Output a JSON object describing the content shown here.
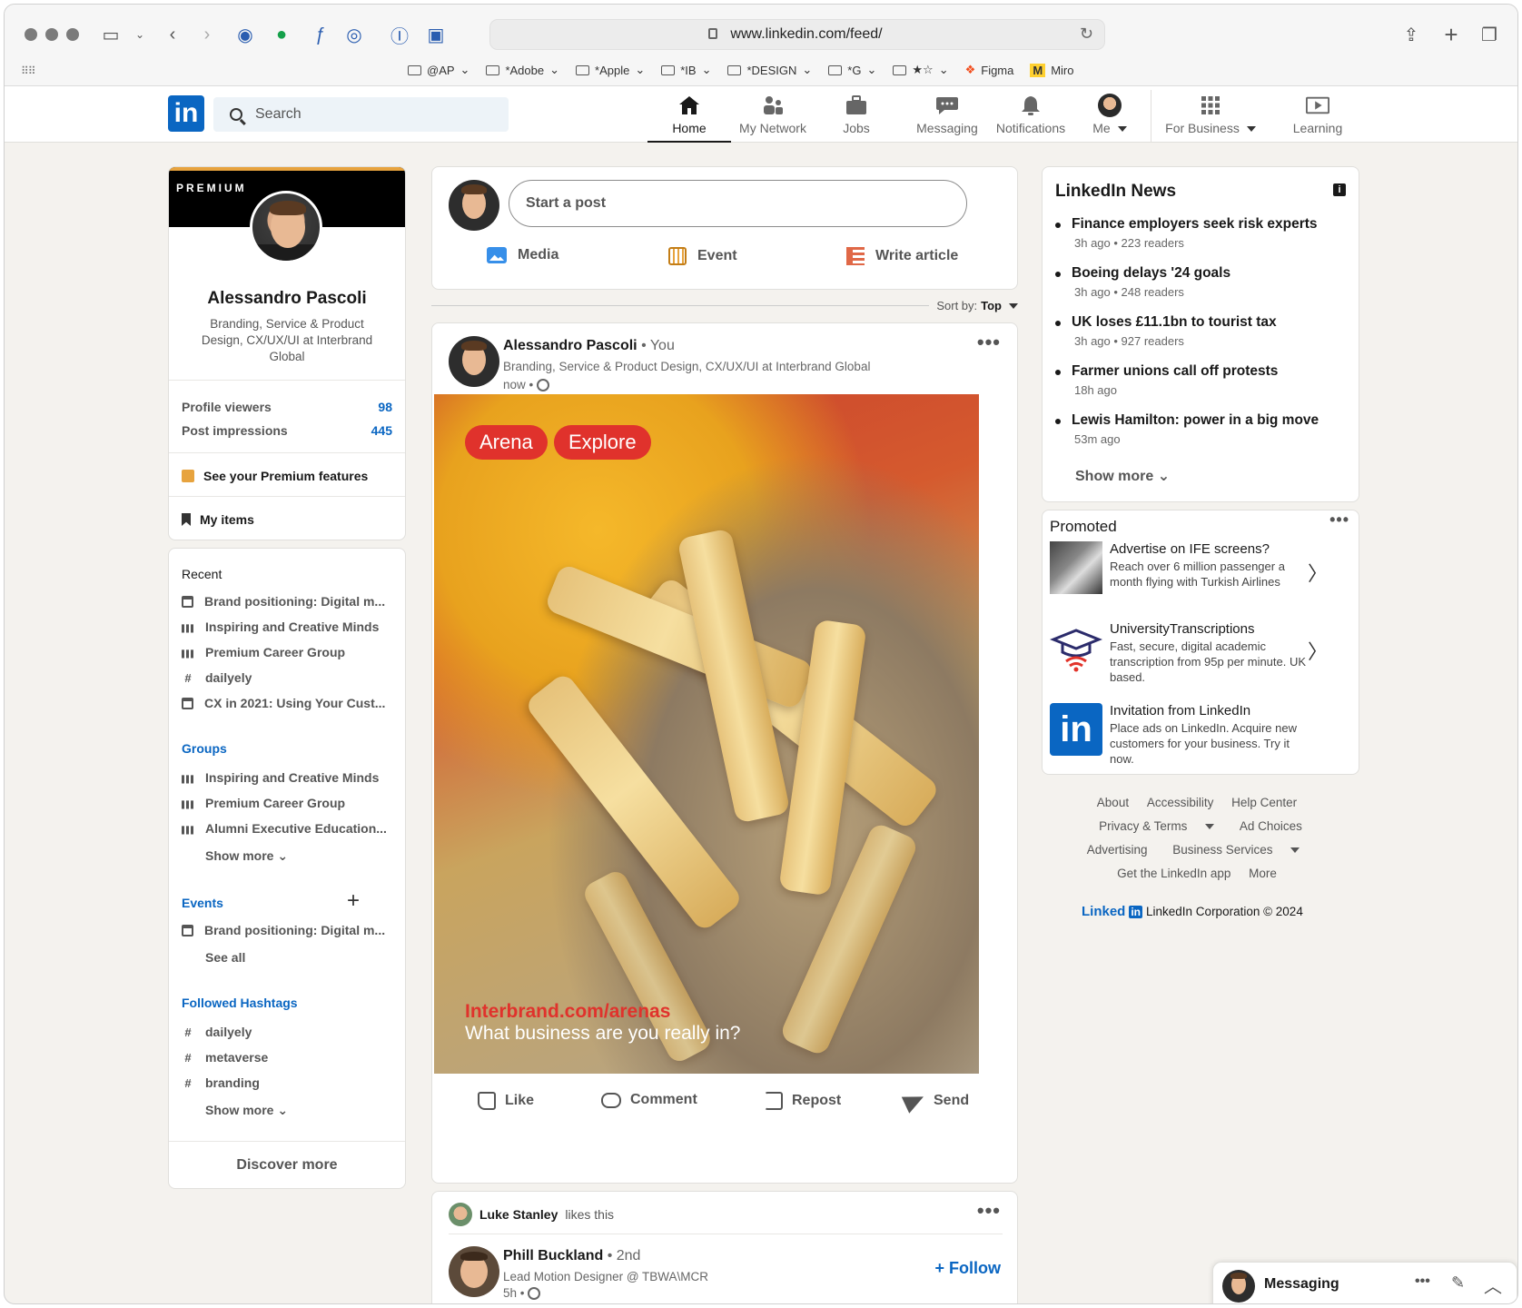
{
  "browser": {
    "url": "www.linkedin.com/feed/",
    "bookmarks": [
      "@AP",
      "*Adobe",
      "*Apple",
      "*IB",
      "*DESIGN",
      "*G",
      "★☆",
      "Figma",
      "Miro"
    ]
  },
  "nav": {
    "logo": "in",
    "search_placeholder": "Search",
    "items": [
      "Home",
      "My Network",
      "Jobs",
      "Messaging",
      "Notifications",
      "Me",
      "For Business",
      "Learning"
    ]
  },
  "profile": {
    "badge": "PREMIUM",
    "name": "Alessandro Pascoli",
    "headline": "Branding, Service & Product Design, CX/UX/UI at Interbrand Global",
    "stats": [
      {
        "label": "Profile viewers",
        "value": "98"
      },
      {
        "label": "Post impressions",
        "value": "445"
      }
    ],
    "premium_link": "See your Premium features",
    "my_items": "My items"
  },
  "sidebar": {
    "recent_title": "Recent",
    "recent": [
      {
        "icon": "calendar-icon",
        "label": "Brand positioning: Digital m..."
      },
      {
        "icon": "group-icon",
        "label": "Inspiring and Creative Minds"
      },
      {
        "icon": "group-icon",
        "label": "Premium Career Group"
      },
      {
        "icon": "hashtag-icon",
        "label": "dailyely"
      },
      {
        "icon": "calendar-icon",
        "label": "CX in 2021: Using Your Cust..."
      }
    ],
    "groups_title": "Groups",
    "groups": [
      "Inspiring and Creative Minds",
      "Premium Career Group",
      "Alumni Executive Education..."
    ],
    "show_more": "Show more",
    "events_title": "Events",
    "events": [
      "Brand positioning: Digital m..."
    ],
    "see_all": "See all",
    "hashtags_title": "Followed Hashtags",
    "hashtags": [
      "dailyely",
      "metaverse",
      "branding"
    ],
    "discover_more": "Discover more"
  },
  "composer": {
    "placeholder": "Start a post",
    "actions": [
      "Media",
      "Event",
      "Write article"
    ]
  },
  "sort": {
    "label": "Sort by:",
    "value": "Top"
  },
  "post": {
    "author": "Alessandro Pascoli",
    "relation": "You",
    "headline": "Branding, Service & Product Design, CX/UX/UI at Interbrand Global",
    "time": "now",
    "tags": [
      "Arena",
      "Explore"
    ],
    "caption_url": "Interbrand.com/arenas",
    "caption_text": "What business are you really in?",
    "actions": [
      "Like",
      "Comment",
      "Repost",
      "Send"
    ]
  },
  "post2": {
    "liker": "Luke Stanley",
    "likes_text": "likes this",
    "author": "Phill Buckland",
    "degree": "2nd",
    "headline": "Lead Motion Designer @ TBWA\\MCR",
    "time": "5h",
    "follow": "Follow"
  },
  "news": {
    "title": "LinkedIn News",
    "items": [
      {
        "headline": "Finance employers seek risk experts",
        "meta": "3h ago • 223 readers"
      },
      {
        "headline": "Boeing delays '24 goals",
        "meta": "3h ago • 248 readers"
      },
      {
        "headline": "UK loses £11.1bn to tourist tax",
        "meta": "3h ago • 927 readers"
      },
      {
        "headline": "Farmer unions call off protests",
        "meta": "18h ago"
      },
      {
        "headline": "Lewis Hamilton: power in a big move",
        "meta": "53m ago"
      }
    ],
    "show_more": "Show more"
  },
  "promoted": {
    "title": "Promoted",
    "items": [
      {
        "title": "Advertise on IFE screens?",
        "desc": "Reach over 6 million passenger a month flying with Turkish Airlines"
      },
      {
        "title": "UniversityTranscriptions",
        "desc": "Fast, secure, digital academic transcription from 95p per minute. UK based."
      },
      {
        "title": "Invitation from LinkedIn",
        "desc": "Place ads on LinkedIn. Acquire new customers for your business. Try it now."
      }
    ]
  },
  "footer": {
    "row1": [
      "About",
      "Accessibility",
      "Help Center"
    ],
    "row2": [
      "Privacy & Terms",
      "Ad Choices"
    ],
    "row3": [
      "Advertising",
      "Business Services"
    ],
    "row4": [
      "Get the LinkedIn app",
      "More"
    ],
    "copyright": "LinkedIn Corporation © 2024",
    "brand": "Linked",
    "brand_box": "in"
  },
  "messaging": {
    "label": "Messaging"
  },
  "colors": {
    "brand": "#0a66c2",
    "premium_gold": "#e7a33e",
    "tag_red": "#e0322c"
  }
}
